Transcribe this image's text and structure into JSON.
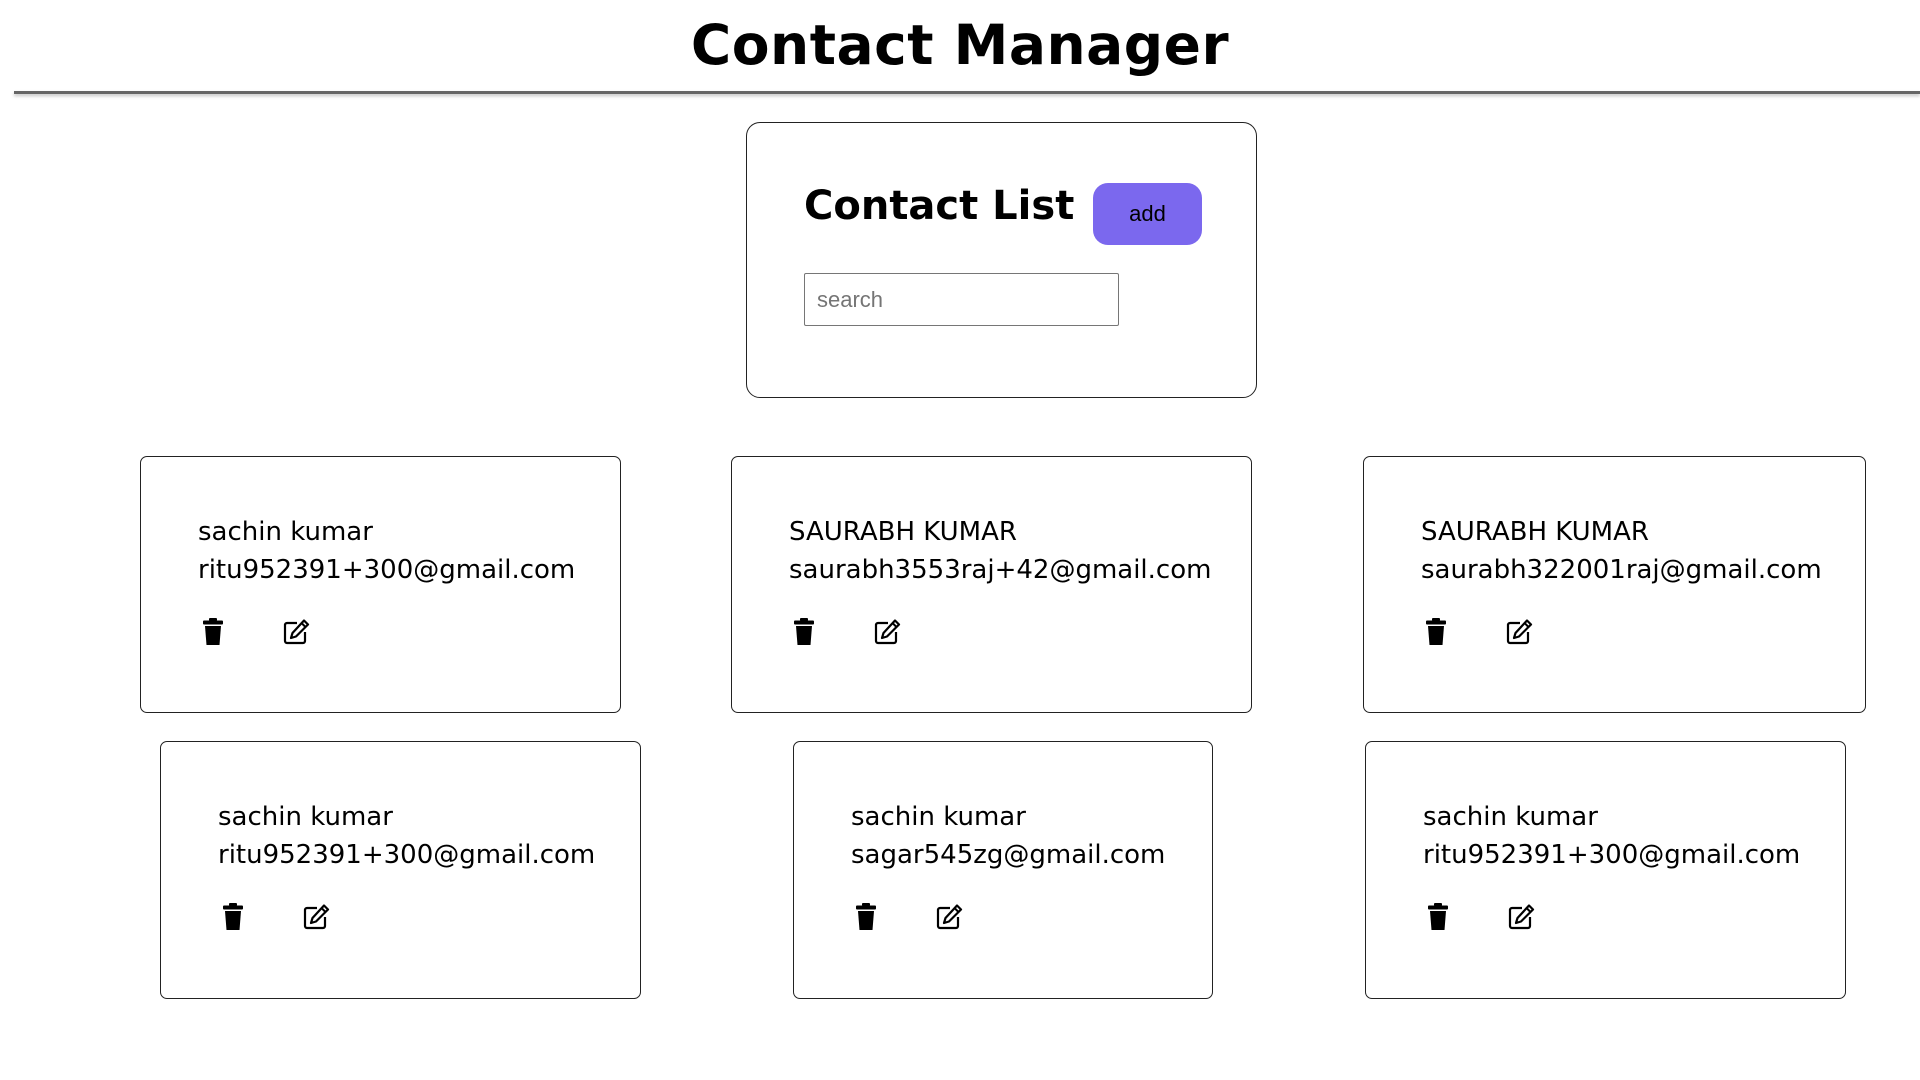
{
  "header": {
    "title": "Contact Manager"
  },
  "contact_list": {
    "title": "Contact List",
    "add_label": "add",
    "search_placeholder": "search",
    "search_value": ""
  },
  "contacts": [
    {
      "name": "sachin kumar",
      "email": "ritu952391+300@gmail.com"
    },
    {
      "name": "SAURABH KUMAR",
      "email": "saurabh3553raj+42@gmail.com"
    },
    {
      "name": "SAURABH KUMAR",
      "email": "saurabh322001raj@gmail.com"
    },
    {
      "name": "sachin kumar",
      "email": "ritu952391+300@gmail.com"
    },
    {
      "name": "sachin kumar",
      "email": "sagar545zg@gmail.com"
    },
    {
      "name": "sachin kumar",
      "email": "ritu952391+300@gmail.com"
    }
  ],
  "icons": {
    "delete": "trash-icon",
    "edit": "edit-icon"
  },
  "colors": {
    "accent": "#7b68ee",
    "text": "#000000",
    "border": "#222222"
  }
}
